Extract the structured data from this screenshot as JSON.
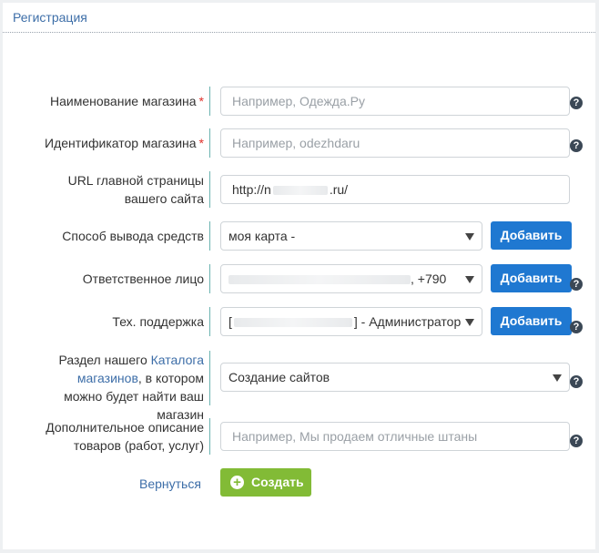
{
  "panel": {
    "title": "Регистрация"
  },
  "form": {
    "store_name": {
      "label": "Наименование магазина",
      "required": "*",
      "placeholder": "Например, Одежда.Ру"
    },
    "store_id": {
      "label": "Идентификатор магазина",
      "required": "*",
      "placeholder": "Например, odezhdaru"
    },
    "site_url": {
      "label_line1": "URL главной страницы",
      "label_line2": "вашего сайта",
      "value_prefix": "http://n",
      "value_suffix": ".ru/"
    },
    "withdrawal": {
      "label": "Способ вывода средств",
      "value": "моя карта - ",
      "add_label": "Добавить"
    },
    "responsible": {
      "label": "Ответственное лицо",
      "value_suffix": ", +790",
      "add_label": "Добавить"
    },
    "support": {
      "label": "Тех. поддержка",
      "value_prefix": "[",
      "value_suffix": "] - Администратор",
      "add_label": "Добавить"
    },
    "catalog_section": {
      "label_part1": "Раздел нашего ",
      "label_link": "Каталога магазинов",
      "label_part2": ", в котором можно будет найти ваш магазин",
      "value": "Создание сайтов"
    },
    "description": {
      "label_line1": "Дополнительное описание",
      "label_line2": "товаров (работ, услуг)",
      "placeholder": "Например, Мы продаем отличные штаны"
    },
    "help_glyph": "?"
  },
  "actions": {
    "back_label": "Вернуться",
    "create_label": "Создать",
    "create_icon_glyph": "+"
  },
  "colors": {
    "accent_blue": "#1f78d1",
    "create_green": "#82bb36",
    "link": "#3d6ea8",
    "required": "#e0302a"
  }
}
